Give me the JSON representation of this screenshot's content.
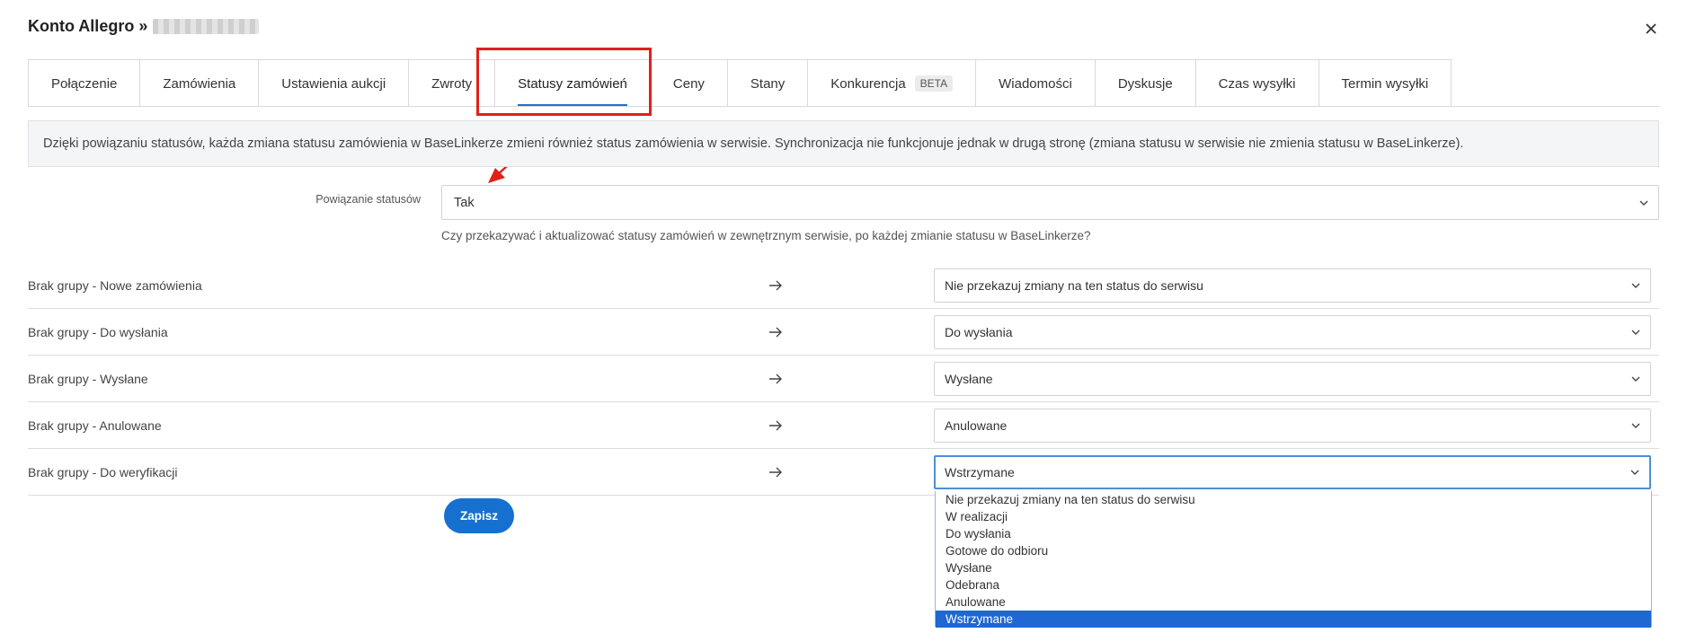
{
  "modal": {
    "title": "Konto Allegro »",
    "close_icon": "close-icon"
  },
  "tabs": [
    {
      "label": "Połączenie"
    },
    {
      "label": "Zamówienia"
    },
    {
      "label": "Ustawienia aukcji"
    },
    {
      "label": "Zwroty"
    },
    {
      "label": "Statusy zamówień",
      "active": true
    },
    {
      "label": "Ceny"
    },
    {
      "label": "Stany"
    },
    {
      "label": "Konkurencja",
      "badge": "BETA"
    },
    {
      "label": "Wiadomości"
    },
    {
      "label": "Dyskusje"
    },
    {
      "label": "Czas wysyłki"
    },
    {
      "label": "Termin wysyłki"
    }
  ],
  "info_text": "Dzięki powiązaniu statusów, każda zmiana statusu zamówienia w BaseLinkerze zmieni również status zamówienia w serwisie. Synchronizacja nie funkcjonuje jednak w drugą stronę (zmiana statusu w serwisie nie zmienia statusu w BaseLinkerze).",
  "status_binding": {
    "label": "Powiązanie statusów",
    "value": "Tak",
    "help": "Czy przekazywać i aktualizować statusy zamówień w zewnętrznym serwisie, po każdej zmianie statusu w BaseLinkerze?"
  },
  "mappings": [
    {
      "source": "Brak grupy - Nowe zamówienia",
      "target": "Nie przekazuj zmiany na ten status do serwisu"
    },
    {
      "source": "Brak grupy - Do wysłania",
      "target": "Do wysłania"
    },
    {
      "source": "Brak grupy - Wysłane",
      "target": "Wysłane"
    },
    {
      "source": "Brak grupy - Anulowane",
      "target": "Anulowane"
    },
    {
      "source": "Brak grupy - Do weryfikacji",
      "target": "Wstrzymane"
    }
  ],
  "save_label": "Zapisz",
  "dropdown_options": [
    "Nie przekazuj zmiany na ten status do serwisu",
    "W realizacji",
    "Do wysłania",
    "Gotowe do odbioru",
    "Wysłane",
    "Odebrana",
    "Anulowane",
    "Wstrzymane"
  ],
  "dropdown_selected": "Wstrzymane",
  "colors": {
    "accent": "#1670d0",
    "highlight_annotation": "#e0201b",
    "selected_option": "#1f67d2"
  }
}
